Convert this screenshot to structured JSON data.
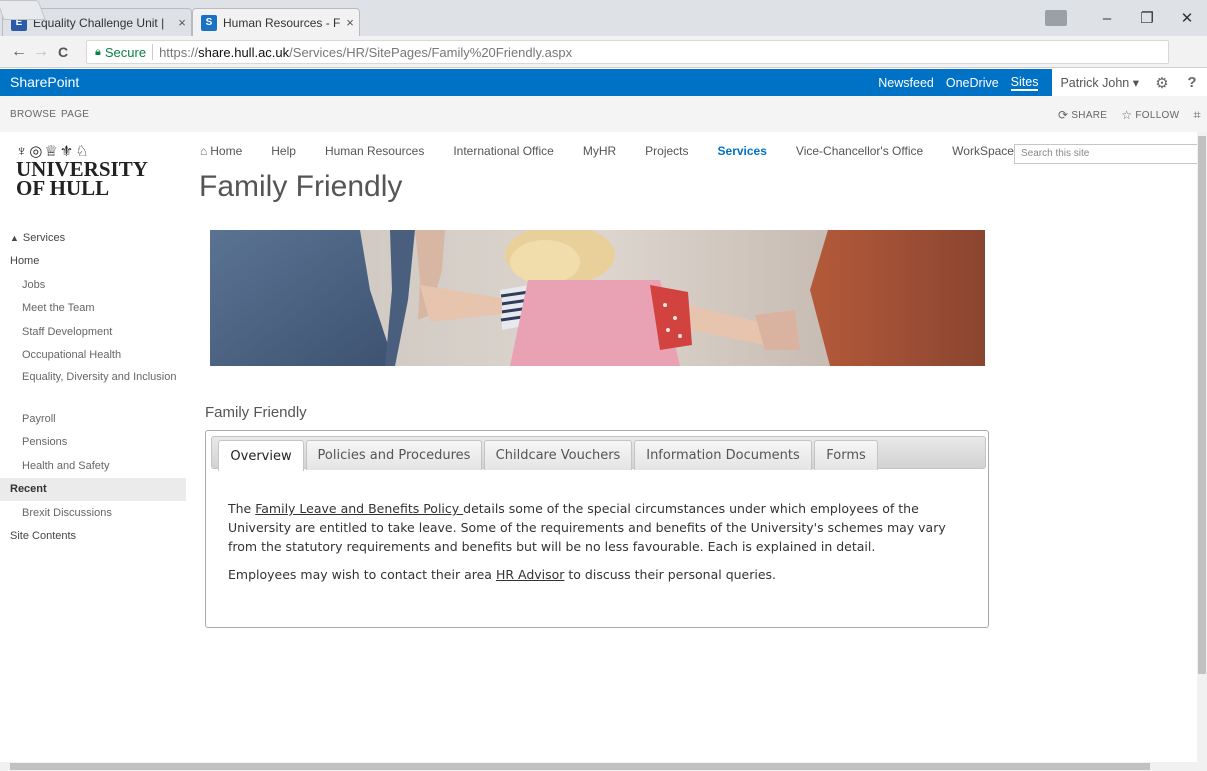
{
  "browser": {
    "tabs": [
      {
        "title": "Equality Challenge Unit |",
        "close": "×",
        "active": false
      },
      {
        "title": "Human Resources - Fam",
        "close": "×",
        "active": true
      }
    ],
    "window_controls": {
      "minimize": "–",
      "maximize": "❐",
      "close": "✕"
    },
    "nav": {
      "back": "←",
      "forward": "→",
      "reload": "C"
    },
    "omnibox": {
      "secure_label": "Secure",
      "url_protocol": "https://",
      "url_host": "share.hull.ac.uk",
      "url_path": "/Services/HR/SitePages/Family%20Friendly.aspx"
    },
    "star": "☆",
    "menu": "⋮"
  },
  "suitebar": {
    "brand": "SharePoint",
    "links": [
      "Newsfeed",
      "OneDrive",
      "Sites"
    ],
    "current_link": "Sites",
    "user": "Patrick John ▾",
    "settings_icon": "⚙",
    "help_icon": "?"
  },
  "ribbon": {
    "tabs": [
      "BROWSE",
      "PAGE"
    ],
    "share": "SHARE",
    "follow": "FOLLOW",
    "focus_icon": "⌗"
  },
  "logo": {
    "crest": "♆◎♕⚜♘",
    "line1": "UNIVERSITY",
    "line2": "OF HULL"
  },
  "topnav": {
    "items": [
      "Home",
      "Help",
      "Human Resources",
      "International Office",
      "MyHR",
      "Projects",
      "Services",
      "Vice-Chancellor's Office",
      "WorkSpaces"
    ],
    "selected": "Services",
    "search_placeholder": "Search this site"
  },
  "page_title": "Family Friendly",
  "leftnav": {
    "up_label": "Services",
    "items": [
      {
        "label": "Home",
        "level": 0
      },
      {
        "label": "Jobs",
        "level": 1
      },
      {
        "label": "Meet the Team",
        "level": 1
      },
      {
        "label": "Staff Development",
        "level": 1
      },
      {
        "label": "Occupational Health",
        "level": 1
      },
      {
        "label": "Equality, Diversity and Inclusion",
        "level": 1
      },
      {
        "label": "Payroll",
        "level": 1
      },
      {
        "label": "Pensions",
        "level": 1
      },
      {
        "label": "Health and Safety",
        "level": 1
      }
    ],
    "recent_heading": "Recent",
    "recent_items": [
      "Brexit Discussions"
    ],
    "site_contents": "Site Contents"
  },
  "section_title": "Family Friendly",
  "panel": {
    "tabs": [
      "Overview",
      "Policies and Procedures",
      "Childcare Vouchers",
      "Information Documents",
      "Forms"
    ],
    "active_tab": "Overview",
    "para1_link": "Family Leave and Benefits Policy ",
    "para1_text": "details some of the special circumstances under which employees of the University are entitled to take leave.  Some of the requirements and benefits of the University's schemes may vary from the statutory requirements and benefits but will be no less favourable.  Each is explained in detail.",
    "para2_before": "Employees may wish to contact their area ",
    "para2_link": "HR Advisor",
    "para2_after": " to discuss their personal queries."
  },
  "colors": {
    "suitebar_blue": "#0072c6",
    "selected_nav": "#0072c6"
  }
}
